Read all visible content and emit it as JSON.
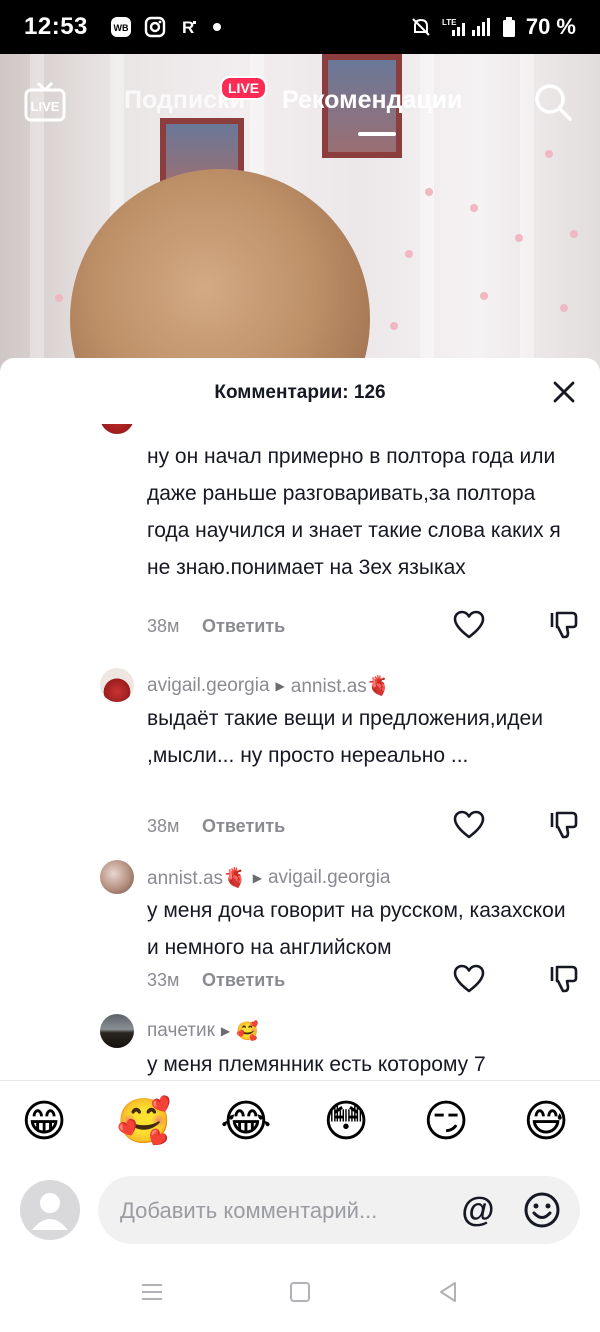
{
  "status_bar": {
    "time": "12:53",
    "app_icons": [
      "wb-icon",
      "instagram-icon",
      "r-app-icon",
      "dot-icon"
    ],
    "network": "LTE",
    "battery": "70 %"
  },
  "top_nav": {
    "tabs": [
      {
        "label": "Подписки",
        "active": false
      },
      {
        "label": "Рекомендации",
        "active": true
      }
    ],
    "live_badge": "LIVE",
    "live_button_label": "LIVE"
  },
  "comments_sheet": {
    "title": "Комментарии: 126",
    "comments": [
      {
        "author": "",
        "reply_to": "",
        "text": "ну он начал примерно в полтора года или даже раньше разговаривать,за полтора года научился и знает такие слова каких я не знаю.понимает на 3ех языках",
        "time": "38м",
        "reply_label": "Ответить"
      },
      {
        "author": "avigail.georgia",
        "reply_to": "annist.as🫀",
        "text": "выдаёт такие вещи и предложения,идеи ,мысли... ну просто нереально ...",
        "time": "38м",
        "reply_label": "Ответить"
      },
      {
        "author": "annist.as🫀",
        "reply_to": "avigail.georgia",
        "text": "у меня доча говорит на русском, казахскои и немного на английском",
        "time": "33м",
        "reply_label": "Ответить"
      },
      {
        "author": "пачетик",
        "reply_to": "🥰",
        "text": "у меня племянник есть которому 7",
        "time": "",
        "reply_label": ""
      }
    ]
  },
  "emoji_bar": [
    "😁",
    "🥰",
    "😂",
    "😳",
    "😏",
    "😅"
  ],
  "comment_input": {
    "placeholder": "Добавить комментарий...",
    "at_symbol": "@"
  },
  "colors": {
    "accent": "#fe2c55",
    "text_primary": "#161823",
    "text_secondary": "#8a8b91"
  }
}
